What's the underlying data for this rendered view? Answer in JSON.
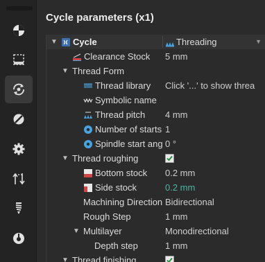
{
  "sidebar": {
    "items": [
      {
        "icon": "origin-target-icon"
      },
      {
        "icon": "stock-dashed-box-icon"
      },
      {
        "icon": "cycle-rotate-icon",
        "active": true
      },
      {
        "icon": "tool-disc-icon"
      },
      {
        "icon": "gear-icon"
      },
      {
        "icon": "approach-retract-icon"
      },
      {
        "icon": "drill-bit-icon"
      },
      {
        "icon": "spindle-circle-icon"
      }
    ]
  },
  "panel": {
    "title": "Cycle parameters (x1)"
  },
  "tree": {
    "cycle": {
      "label": "Cycle",
      "value": "Threading"
    },
    "clearance_stock": {
      "label": "Clearance Stock",
      "value": "5 mm"
    },
    "thread_form": {
      "label": "Thread Form"
    },
    "thread_library": {
      "label": "Thread library",
      "value": "Click '...' to show threa"
    },
    "symbolic_name": {
      "label": "Symbolic name",
      "value": ""
    },
    "thread_pitch": {
      "label": "Thread pitch",
      "value": "4 mm"
    },
    "number_of_starts": {
      "label": "Number of starts",
      "value": "1"
    },
    "spindle_start_angle": {
      "label": "Spindle start ang",
      "value": "0 °"
    },
    "thread_roughing": {
      "label": "Thread roughing",
      "checked": true
    },
    "bottom_stock": {
      "label": "Bottom stock",
      "value": "0.2 mm"
    },
    "side_stock": {
      "label": "Side stock",
      "value": "0.2 mm"
    },
    "machining_direction": {
      "label": "Machining Direction",
      "value": "Bidirectional"
    },
    "rough_step": {
      "label": "Rough Step",
      "value": "1 mm"
    },
    "multilayer": {
      "label": "Multilayer",
      "value": "Monodirectional"
    },
    "depth_step": {
      "label": "Depth step",
      "value": "1 mm"
    },
    "thread_finishing": {
      "label": "Thread finishing",
      "checked": true
    }
  },
  "colors": {
    "accent_teal": "#4fb3a6",
    "icon_blue": "#4aa3e0"
  }
}
